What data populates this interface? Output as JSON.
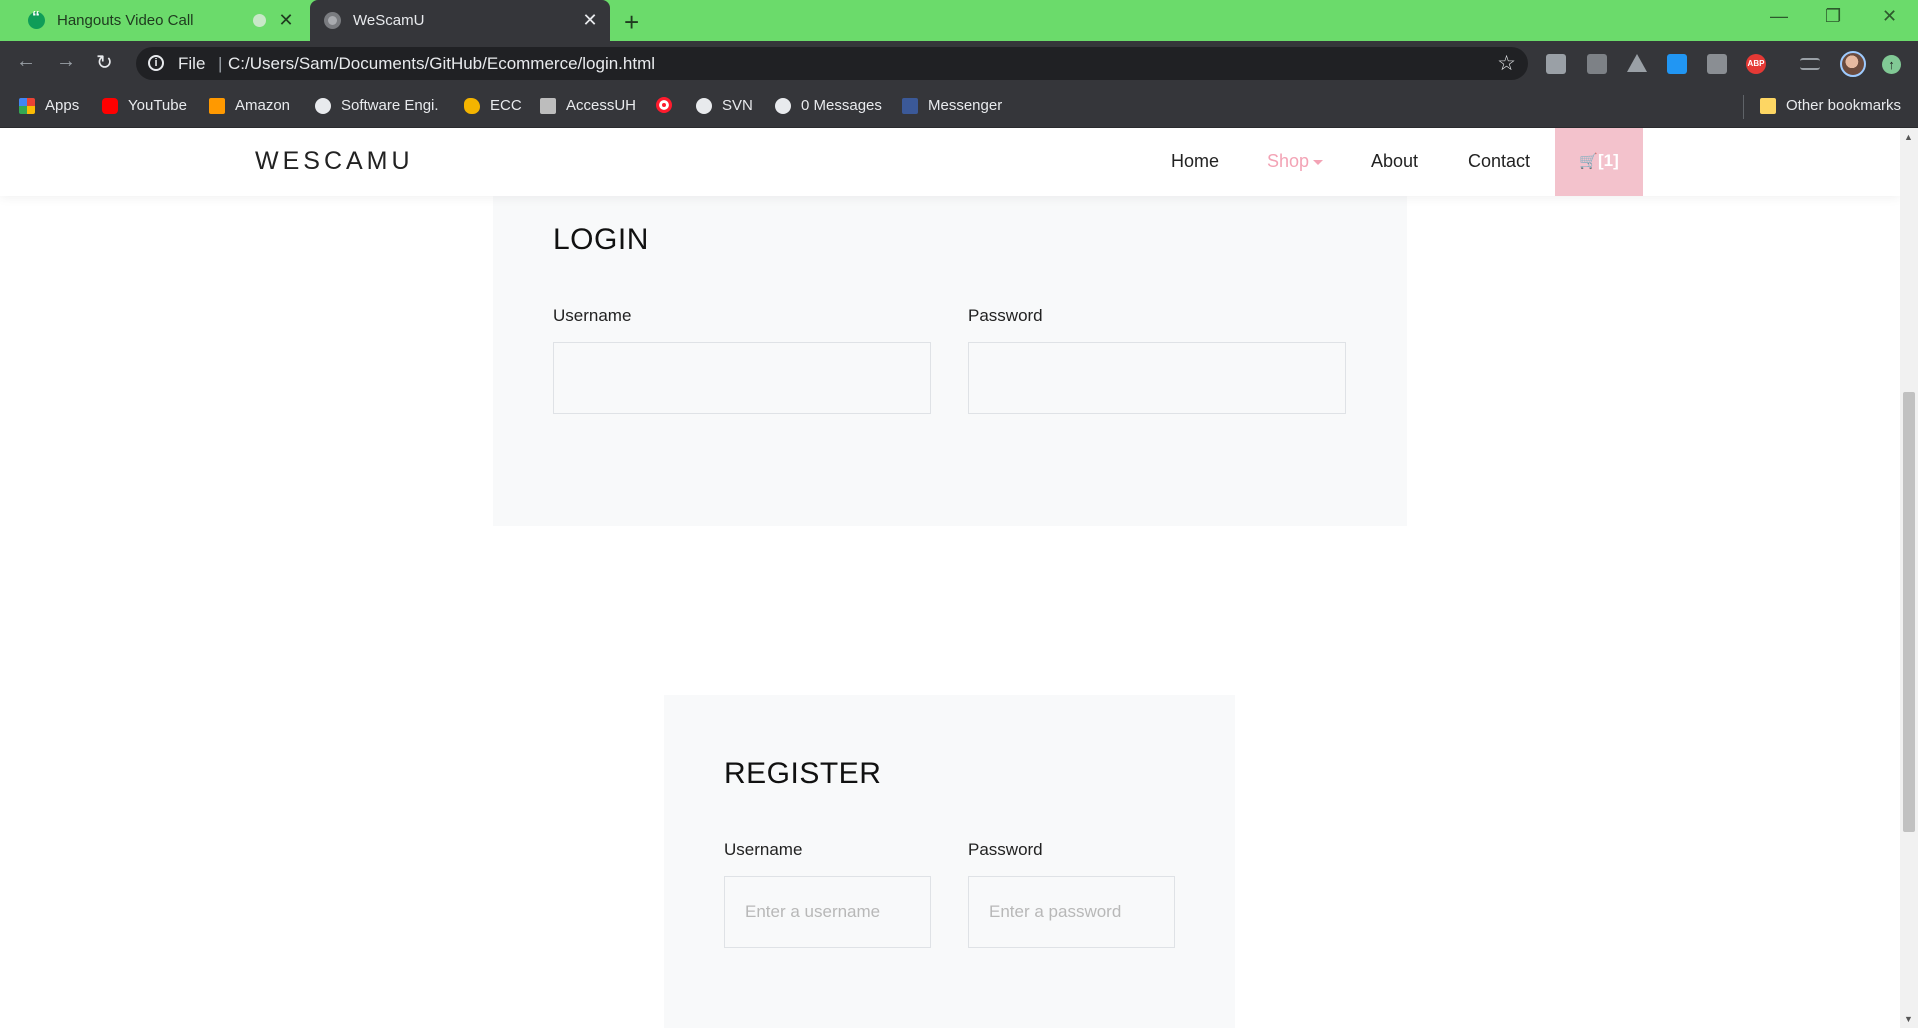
{
  "browser": {
    "tabs": [
      {
        "title": "Hangouts Video Call",
        "close": "✕"
      },
      {
        "title": "WeScamU",
        "close": "✕"
      }
    ],
    "new_tab": "+",
    "window_controls": {
      "minimize": "—",
      "restore": "❐",
      "close": "✕"
    },
    "nav": {
      "back": "←",
      "forward": "→",
      "reload": "↻"
    },
    "address": {
      "scheme_label": "File",
      "separator": "|",
      "url": "C:/Users/Sam/Documents/GitHub/Ecommerce/login.html",
      "info_glyph": "i",
      "star": "☆"
    },
    "extensions": [
      {
        "name": "puzzle-extension-icon",
        "color": "#9aa0a6"
      },
      {
        "name": "clipboard-extension-icon",
        "color": "#9aa0a6"
      },
      {
        "name": "drive-extension-icon",
        "color": "#9aa0a6"
      },
      {
        "name": "window-extension-icon",
        "color": "#2196f3"
      },
      {
        "name": "briefcase-extension-icon",
        "color": "#9aa0a6"
      },
      {
        "name": "adblock-plus-icon",
        "color": "#e53935"
      },
      {
        "name": "reading-list-icon",
        "color": "#9aa0a6"
      }
    ],
    "adblock_label": "ABP",
    "update_glyph": "↑",
    "bookmarks": [
      {
        "label": "Apps",
        "icon": "apps-grid-icon",
        "color": "#ea4335"
      },
      {
        "label": "YouTube",
        "icon": "youtube-icon",
        "color": "#ff0000"
      },
      {
        "label": "Amazon",
        "icon": "amazon-icon",
        "color": "#ff9900"
      },
      {
        "label": "Software Engi.",
        "icon": "globe-icon",
        "color": "#e8eaed"
      },
      {
        "label": "ECC",
        "icon": "ecc-icon",
        "color": "#f4b400"
      },
      {
        "label": "AccessUH",
        "icon": "accessuh-icon",
        "color": "#bdbdbd"
      },
      {
        "label": "",
        "icon": "opera-icon",
        "color": "#ff1b2d"
      },
      {
        "label": "SVN",
        "icon": "globe-icon",
        "color": "#e8eaed"
      },
      {
        "label": "0 Messages",
        "icon": "globe-icon",
        "color": "#e8eaed"
      },
      {
        "label": "Messenger",
        "icon": "facebook-icon",
        "color": "#3b5998"
      }
    ],
    "other_bookmarks": {
      "label": "Other bookmarks",
      "icon": "folder-icon",
      "color": "#fdd663"
    }
  },
  "site": {
    "brand": "WESCAMU",
    "nav": [
      {
        "label": "Home"
      },
      {
        "label": "Shop"
      },
      {
        "label": "About"
      },
      {
        "label": "Contact"
      }
    ],
    "cart_label": "[1]",
    "cart_glyph": "🛒",
    "accent_color": "#f3a3b5"
  },
  "login": {
    "title": "LOGIN",
    "username_label": "Username",
    "password_label": "Password",
    "username_value": "",
    "password_value": "",
    "username_placeholder": "",
    "password_placeholder": ""
  },
  "register": {
    "title": "REGISTER",
    "username_label": "Username",
    "password_label": "Password",
    "username_placeholder": "Enter a username",
    "password_placeholder": "Enter a password"
  }
}
